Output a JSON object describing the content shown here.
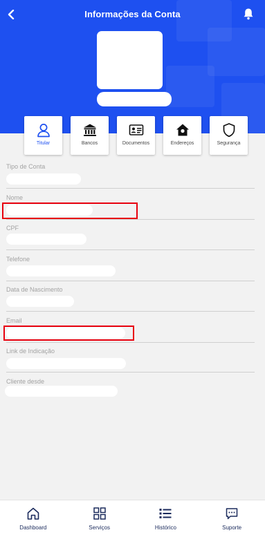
{
  "header": {
    "title": "Informações da Conta",
    "background_color": "#1e50f0",
    "back_icon": "chevron-left-icon",
    "bell_icon": "bell-icon"
  },
  "tabs": [
    {
      "label": "Titular",
      "icon": "user-icon",
      "active": true
    },
    {
      "label": "Bancos",
      "icon": "bank-icon",
      "active": false
    },
    {
      "label": "Documentos",
      "icon": "id-card-icon",
      "active": false
    },
    {
      "label": "Endereços",
      "icon": "home-icon",
      "active": false
    },
    {
      "label": "Segurança",
      "icon": "shield-icon",
      "active": false
    }
  ],
  "fields": [
    {
      "label": "Tipo de Conta"
    },
    {
      "label": "Nome"
    },
    {
      "label": "CPF"
    },
    {
      "label": "Telefone"
    },
    {
      "label": "Data de Nascimento"
    },
    {
      "label": "Email"
    },
    {
      "label": "Link de Indicação"
    },
    {
      "label": "Cliente desde"
    }
  ],
  "bottom_nav": [
    {
      "label": "Dashboard",
      "icon": "home-outline-icon"
    },
    {
      "label": "Serviços",
      "icon": "grid-icon"
    },
    {
      "label": "Histórico",
      "icon": "list-icon"
    },
    {
      "label": "Suporte",
      "icon": "chat-icon"
    }
  ],
  "colors": {
    "accent": "#1e50f0",
    "highlight": "#e8000d",
    "nav_text": "#1a2a5c"
  }
}
